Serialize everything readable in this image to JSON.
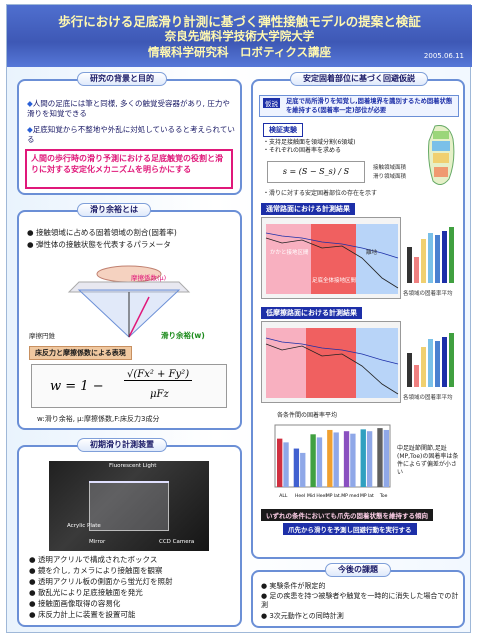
{
  "header": {
    "title1": "歩行における足底滑り計測に基づく弾性接触モデルの提案と検証",
    "title2": "奈良先端科学技術大学院大学",
    "title3": "情報科学研究科　ロボティクス講座",
    "date": "2005.06.11"
  },
  "background": {
    "tab": "研究の背景と目的",
    "bullet1": "人間の足底には筆と同様, 多くの触覚受容器があり, 圧力や滑りを知覚できる",
    "bullet2": "足底知覚から不整地や外乱に対処しているると考えられている",
    "highlight": "人間の歩行時の滑り予測における足底触覚の役割と滑りに対する安定化メカニズムを明らかにする"
  },
  "slip": {
    "tab": "滑り余裕とは",
    "bullet1": "接触領域に占める固着領域の割合(固着率)",
    "bullet2": "弾性体の接触状態を代表するパラメータ",
    "friction_label": "摩擦係数(μ)",
    "cone_label": "摩擦円錐",
    "margin_label": "滑り余裕(w)",
    "formula_head": "床反力と摩擦係数による表現",
    "formula_lhs": "w = 1 −",
    "formula_num": "√(Fx² + Fy²)",
    "formula_den": "μFz",
    "caption": "w:滑り余裕, μ:摩擦係数,F:床反力3成分"
  },
  "device": {
    "tab": "初期滑り計測装置",
    "photo_labels": [
      "Fluorescent Light",
      "Acrylic Plate",
      "Mirror",
      "CCD Camera"
    ],
    "bullets": [
      "透明アクリルで構成されたボックス",
      "鏡を介し, カメラにより接触面を観察",
      "透明アクリル板の側面から蛍光灯を照射",
      "散乱光により足底接触面を発光",
      "接触面画像取得の容易化",
      "床反力計上に装置を設置可能"
    ]
  },
  "hypothesis": {
    "tab": "安定固着部位に基づく回避仮説",
    "question_prefix": "仮説",
    "question": "足底で局所滑りを知覚し,固着境界を識別するため固着状態を維持する(固着率一定)部位が必要",
    "verify_tab": "検証実験",
    "verify_items": [
      "支持足接触面を領域分割(6領域)",
      "それぞれの固着率を求める"
    ],
    "formula": "s = (S − S_s) / S",
    "region_label": "接触領域面積",
    "region_label2": "滑り領域面積",
    "note": "滑りに対する安定固着部位の存在を示す",
    "normal_tab": "通常路面における計測結果",
    "low_tab": "低摩擦路面における計測結果",
    "chart_caption": "各領域の固着率平均",
    "legend_items": [
      "ALL",
      "Heel",
      "Mid Heel",
      "MP lat.",
      "MP med",
      "MP lat",
      "Toe"
    ],
    "band_labels": [
      "かかと接地区間",
      "足底全体接地区間",
      "離地"
    ],
    "avg_title": "各条件間の固着率平均",
    "side_note": "中足趾節関節,足趾(MP,Toe)の固着率は条件によらず偏差が小さい",
    "conclusion_line1": "いずれの条件においても爪先の固着状態を維持する傾向",
    "conclusion_line2": "爪先から滑りを予測し回避行動を実行する"
  },
  "future": {
    "tab": "今後の課題",
    "bullets": [
      "実験条件が限定的",
      "足の疾患を持つ被験者や触覚を一時的に消失した場合での計測",
      "3次元動作との同時計測"
    ]
  },
  "colors": {
    "header": "#3e58b5",
    "accent": "#e0187a",
    "border": "#6b8fd6"
  },
  "chart_data": [
    {
      "type": "bar",
      "title": "各条件間の固着率平均",
      "categories": [
        "ALL",
        "Heel",
        "Mid Heel",
        "MP lat.",
        "MP med",
        "MP lat",
        "Toe"
      ],
      "series": [
        {
          "values": [
            0.78,
            0.62,
            0.85,
            0.92,
            0.9,
            0.93,
            0.95
          ]
        },
        {
          "values": [
            0.72,
            0.55,
            0.8,
            0.88,
            0.86,
            0.9,
            0.92
          ]
        }
      ],
      "ylim": [
        0,
        1
      ]
    }
  ]
}
